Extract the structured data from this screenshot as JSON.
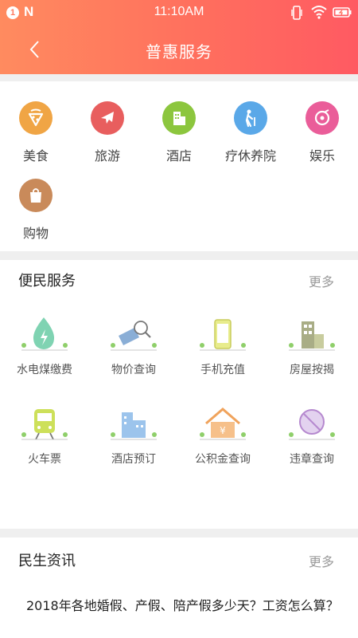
{
  "status_bar": {
    "time": "11:10AM",
    "notification_count": "1",
    "app_letter": "N"
  },
  "header": {
    "title": "普惠服务"
  },
  "categories": [
    {
      "label": "美食",
      "icon": "food-icon",
      "color": "#f0a545"
    },
    {
      "label": "旅游",
      "icon": "plane-icon",
      "color": "#e85e5e"
    },
    {
      "label": "酒店",
      "icon": "hotel-icon",
      "color": "#8cc63e"
    },
    {
      "label": "疗休养院",
      "icon": "elder-icon",
      "color": "#5aa8e8"
    },
    {
      "label": "娱乐",
      "icon": "music-icon",
      "color": "#ea5d99"
    },
    {
      "label": "购物",
      "icon": "shopping-bag-icon",
      "color": "#c98a5a"
    }
  ],
  "convenience": {
    "title": "便民服务",
    "more": "更多",
    "items": [
      {
        "label": "水电煤缴费",
        "icon": "utility-drop-icon"
      },
      {
        "label": "物价查询",
        "icon": "price-tag-icon"
      },
      {
        "label": "手机充值",
        "icon": "phone-icon"
      },
      {
        "label": "房屋按揭",
        "icon": "building-icon"
      },
      {
        "label": "火车票",
        "icon": "train-icon"
      },
      {
        "label": "酒店预订",
        "icon": "hotel-building-icon"
      },
      {
        "label": "公积金查询",
        "icon": "house-fund-icon"
      },
      {
        "label": "违章查询",
        "icon": "violation-icon"
      }
    ]
  },
  "news": {
    "title": "民生资讯",
    "more": "更多",
    "items": [
      {
        "headline": "2018年各地婚假、产假、陪产假多少天？工资怎么算？"
      }
    ]
  }
}
